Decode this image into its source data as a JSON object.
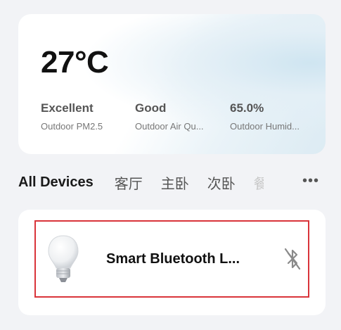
{
  "weather": {
    "temperature": "27°C",
    "metrics": [
      {
        "value": "Excellent",
        "label": "Outdoor PM2.5"
      },
      {
        "value": "Good",
        "label": "Outdoor Air Qu..."
      },
      {
        "value": "65.0%",
        "label": "Outdoor Humid..."
      }
    ]
  },
  "tabs": {
    "items": [
      "All Devices",
      "客厅",
      "主卧",
      "次卧",
      "餐"
    ],
    "more": "•••"
  },
  "device": {
    "name": "Smart  Bluetooth L...",
    "icon": "bulb-icon",
    "status_icon": "bluetooth-off-icon"
  }
}
